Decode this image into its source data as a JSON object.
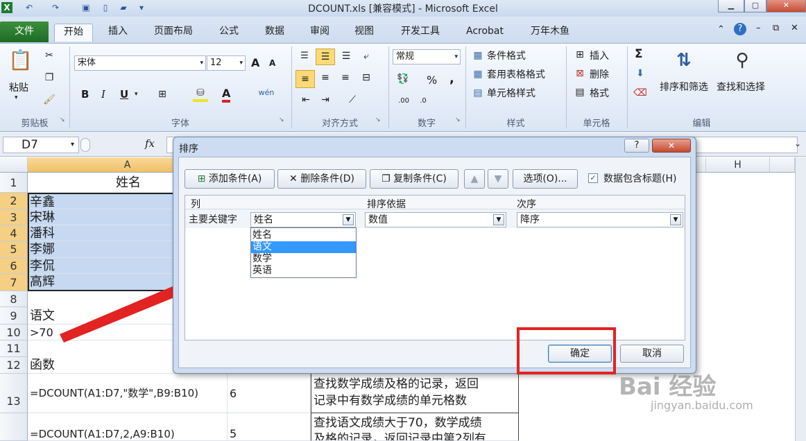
{
  "window": {
    "title": "DCOUNT.xls  [兼容模式]  -  Microsoft Excel"
  },
  "tabs": [
    "文件",
    "开始",
    "插入",
    "页面布局",
    "公式",
    "数据",
    "审阅",
    "视图",
    "开发工具",
    "Acrobat",
    "万年木鱼"
  ],
  "ribbon": {
    "clipboard": {
      "paste": "粘贴",
      "label": "剪贴板"
    },
    "font": {
      "name": "宋体",
      "size": "12",
      "label": "字体",
      "bold": "B",
      "italic": "I",
      "underline": "U",
      "grow": "A",
      "shrink": "A",
      "color_a": "A"
    },
    "align": {
      "label": "对齐方式"
    },
    "number": {
      "format": "常规",
      "label": "数字",
      "percent": "%",
      "comma": ","
    },
    "styles": {
      "conditional": "条件格式",
      "table": "套用表格格式",
      "cell": "单元格样式",
      "label": "样式"
    },
    "cells": {
      "insert": "插入",
      "delete": "删除",
      "format": "格式",
      "label": "单元格"
    },
    "editing": {
      "sum": "Σ",
      "sort_filter": "排序和筛选",
      "find_select": "查找和选择",
      "label": "编辑"
    }
  },
  "formula_bar": {
    "name_box": "D7",
    "fx": "fx"
  },
  "grid": {
    "col_a": "A",
    "col_h": "H",
    "rows": [
      "1",
      "2",
      "3",
      "4",
      "5",
      "6",
      "7",
      "8",
      "9",
      "10",
      "11",
      "12",
      "13"
    ],
    "a1": "姓名",
    "names": [
      "辛鑫",
      "宋琳",
      "潘科",
      "李娜",
      "李侃",
      "高辉"
    ],
    "a9": "语文",
    "a10": ">70",
    "a12": "函数",
    "a13": "=DCOUNT(A1:D7,\"数学\",B9:B10)",
    "b13": "6",
    "d13_line1": "查找数学成绩及格的记录，返回",
    "d13_line2": "记录中有数学成绩的单元格数",
    "a14": "=DCOUNT(A1:D7,2,A9:B10)",
    "b14": "5",
    "d14_line1": "查找语文成绩大于70，数学成绩",
    "d14_line2": "及格的记录，返回记录中第2列有"
  },
  "dialog": {
    "title": "排序",
    "help": "?",
    "close": "✕",
    "add": "添加条件(A)",
    "delete": "删除条件(D)",
    "copy": "复制条件(C)",
    "options": "选项(O)...",
    "header_checkbox": "数据包含标题(H)",
    "col_header": "列",
    "basis_header": "排序依据",
    "order_header": "次序",
    "primary_key": "主要关键字",
    "key_value": "姓名",
    "basis_value": "数值",
    "order_value": "降序",
    "key_options": [
      "姓名",
      "语文",
      "数学",
      "英语"
    ],
    "selected_option": "语文",
    "ok": "确定",
    "cancel": "取消"
  },
  "watermark": {
    "text": "Bai 经验",
    "url": "jingyan.baidu.com"
  },
  "colors": {
    "annotation_red": "#e32222",
    "selection_blue": "#c6d9f1",
    "file_tab_green": "#2a7c31"
  }
}
